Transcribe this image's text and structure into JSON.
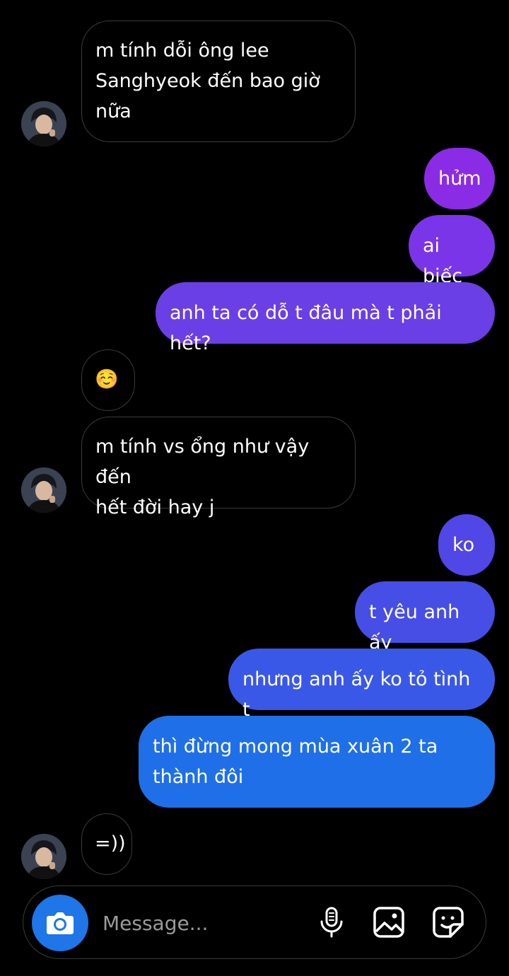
{
  "colors": {
    "background": "#000000",
    "received_border": "#3a3a3a",
    "sent_gradient": [
      "#8a2be6",
      "#7a35e8",
      "#6a3fe6",
      "#5146e6",
      "#474ee6",
      "#3a58e8",
      "#1f6fe8"
    ],
    "camera_button": "#1e76e8"
  },
  "messages": [
    {
      "sender": "other",
      "text": "m tính dỗi ông lee\nSanghyeok đến bao giờ\nnữa"
    },
    {
      "sender": "me",
      "text": "hửm"
    },
    {
      "sender": "me",
      "text": "ai biếc"
    },
    {
      "sender": "me",
      "text": "anh ta có dỗ t đâu mà t phải hết?"
    },
    {
      "sender": "other",
      "text": "☺️"
    },
    {
      "sender": "other",
      "text": "m tính vs ổng như vậy đến\nhết đời hay j"
    },
    {
      "sender": "me",
      "text": "ko"
    },
    {
      "sender": "me",
      "text": "t yêu anh ấy"
    },
    {
      "sender": "me",
      "text": "nhưng anh ấy ko tỏ tình t"
    },
    {
      "sender": "me",
      "text": "thì đừng mong mùa xuân 2 ta\nthành đôi"
    },
    {
      "sender": "other",
      "text": "=))"
    }
  ],
  "composer": {
    "placeholder": "Message...",
    "icons": [
      "camera-icon",
      "microphone-icon",
      "gallery-icon",
      "sticker-icon"
    ]
  }
}
